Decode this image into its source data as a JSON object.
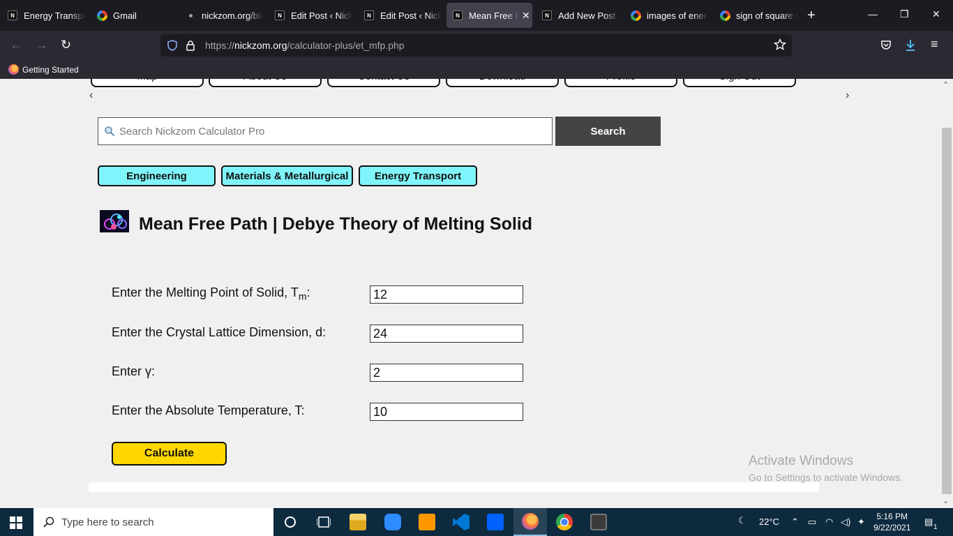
{
  "browser": {
    "tabs": [
      {
        "label": "Energy Transport",
        "icon": "nickzom-icon"
      },
      {
        "label": "Gmail",
        "icon": "google-icon"
      },
      {
        "label": "nickzom.org/blog",
        "icon": "dot-icon"
      },
      {
        "label": "Edit Post ‹ Nickzom",
        "icon": "nickzom-icon"
      },
      {
        "label": "Edit Post ‹ Nickzom",
        "icon": "nickzom-icon"
      },
      {
        "label": "Mean Free Path",
        "icon": "nickzom-icon",
        "active": true
      },
      {
        "label": "Add New Post ‹",
        "icon": "nickzom-icon"
      },
      {
        "label": "images of energy",
        "icon": "google-icon"
      },
      {
        "label": "sign of square root",
        "icon": "google-icon"
      }
    ],
    "url_domain": "nickzom.org",
    "url_prefix": "https://",
    "url_path": "/calculator-plus/et_mfp.php",
    "bookmark": "Getting Started"
  },
  "page": {
    "topnav": [
      "Map",
      "About Us",
      "Contact Us",
      "Download",
      "Profile",
      "Sign Out"
    ],
    "search": {
      "placeholder": "Search Nickzom Calculator Pro",
      "button": "Search"
    },
    "categories": [
      "Engineering",
      "Materials & Metallurgical",
      "Energy Transport"
    ],
    "title": "Mean Free Path | Debye Theory of Melting Solid",
    "fields": [
      {
        "label_main": "Enter the Melting Point of Solid, T",
        "label_sub": "m",
        "label_end": ":",
        "value": "12"
      },
      {
        "label_main": "Enter the Crystal Lattice Dimension, d:",
        "value": "24"
      },
      {
        "label_main": "Enter γ:",
        "value": "2"
      },
      {
        "label_main": "Enter the Absolute Temperature, T:",
        "value": "10"
      }
    ],
    "calculate_label": "Calculate",
    "watermark": {
      "line1": "Activate Windows",
      "line2": "Go to Settings to activate Windows."
    }
  },
  "taskbar": {
    "search_placeholder": "Type here to search",
    "weather": "22°C",
    "time": "5:16 PM",
    "date": "9/22/2021",
    "notification_count": "1",
    "apps": [
      "cortana-icon",
      "task-view-icon",
      "file-explorer-icon",
      "zoom-icon",
      "sublime-icon",
      "vscode-icon",
      "dropbox-icon",
      "firefox-icon",
      "chrome-icon",
      "calculator-icon"
    ]
  }
}
